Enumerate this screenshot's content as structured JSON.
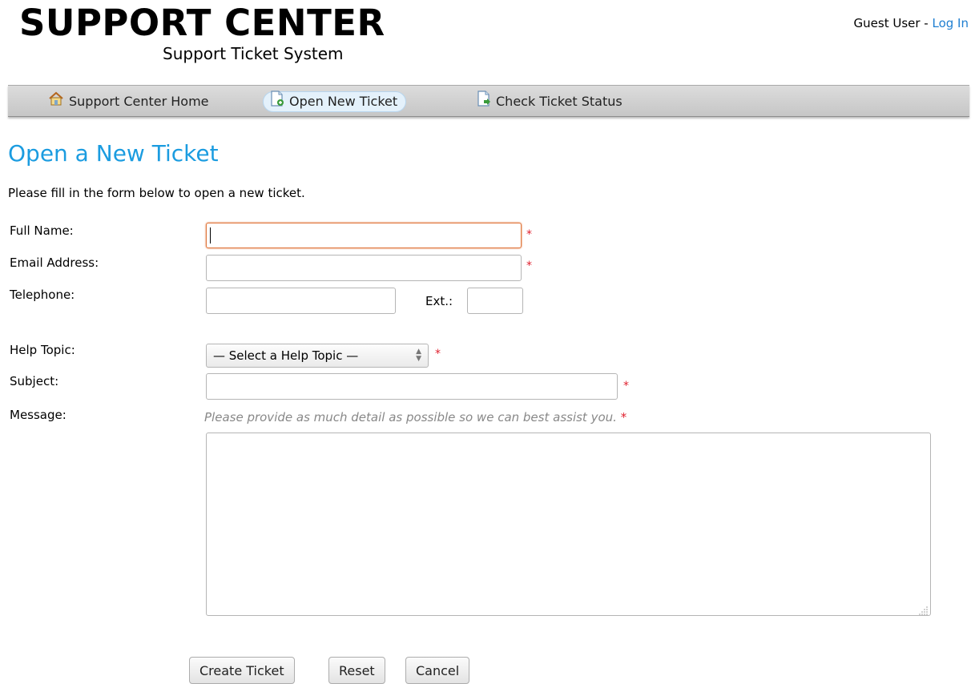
{
  "header": {
    "title": "SUPPORT CENTER",
    "subtitle": "Support Ticket System",
    "user_label": "Guest User - ",
    "login_link": "Log In"
  },
  "nav": {
    "items": [
      {
        "label": "Support Center Home",
        "icon": "home-icon"
      },
      {
        "label": "Open New Ticket",
        "icon": "new-ticket-icon",
        "active": true
      },
      {
        "label": "Check Ticket Status",
        "icon": "ticket-status-icon"
      }
    ]
  },
  "page": {
    "heading": "Open a New Ticket",
    "intro": "Please fill in the form below to open a new ticket."
  },
  "form": {
    "full_name": {
      "label": "Full Name:",
      "value": ""
    },
    "email": {
      "label": "Email Address:",
      "value": ""
    },
    "telephone": {
      "label": "Telephone:",
      "value": ""
    },
    "ext": {
      "label": "Ext.:",
      "value": ""
    },
    "help_topic": {
      "label": "Help Topic:",
      "selected": "— Select a Help Topic —"
    },
    "subject": {
      "label": "Subject:",
      "value": ""
    },
    "message": {
      "label": "Message:",
      "hint": "Please provide as much detail as possible so we can best assist you. ",
      "value": ""
    },
    "required_marker": "*"
  },
  "buttons": {
    "create": "Create Ticket",
    "reset": "Reset",
    "cancel": "Cancel"
  },
  "colors": {
    "accent": "#1b9ce0",
    "required": "#e0212f",
    "focus": "#e0763c",
    "link": "#1f7fd1"
  }
}
